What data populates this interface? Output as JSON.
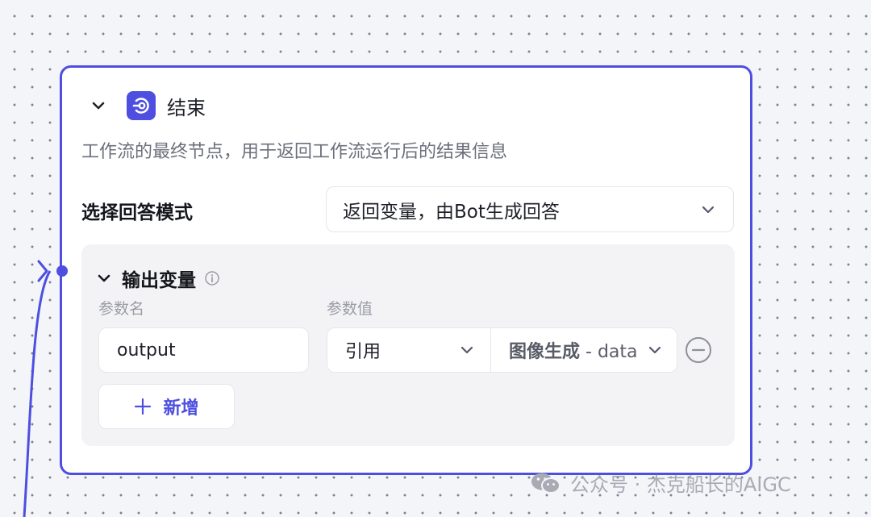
{
  "node": {
    "title": "结束",
    "description": "工作流的最终节点，用于返回工作流运行后的结果信息",
    "icon": "end-node-icon",
    "accent_color": "#4e4fe0"
  },
  "answer_mode": {
    "label": "选择回答模式",
    "selected": "返回变量，由Bot生成回答"
  },
  "output_vars": {
    "title": "输出变量",
    "col_name": "参数名",
    "col_value": "参数值",
    "rows": [
      {
        "name": "output",
        "ref_type": "引用",
        "source_node": "图像生成",
        "source_sep": " - ",
        "source_var": "data"
      }
    ],
    "add_label": "新增"
  },
  "watermark": "公众号 · 杰克船长的AIGC"
}
